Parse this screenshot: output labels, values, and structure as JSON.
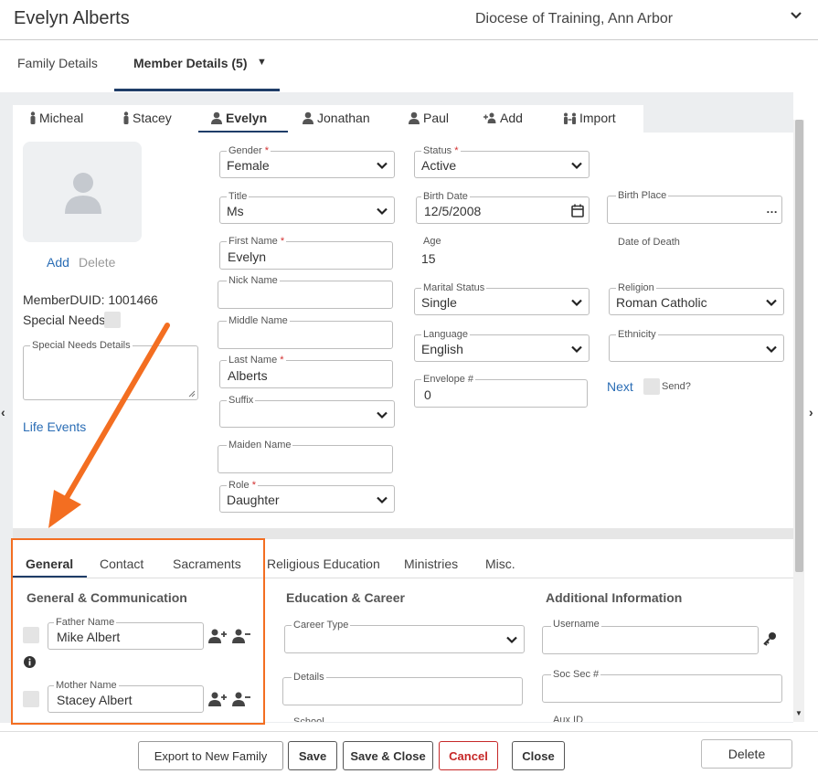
{
  "header": {
    "title": "Evelyn Alberts",
    "organization": "Diocese of Training, Ann Arbor"
  },
  "top_tabs": [
    {
      "label": "Family Details"
    },
    {
      "label": "Member Details (5)"
    }
  ],
  "member_tabs": [
    {
      "label": "Micheal"
    },
    {
      "label": "Stacey"
    },
    {
      "label": "Evelyn"
    },
    {
      "label": "Jonathan"
    },
    {
      "label": "Paul"
    },
    {
      "label": "Add"
    },
    {
      "label": "Import"
    }
  ],
  "photo": {
    "add": "Add",
    "delete": "Delete"
  },
  "member_duid": "MemberDUID: 1001466",
  "special_needs": "Special Needs",
  "special_needs_details": "Special Needs Details",
  "life_events": "Life Events",
  "fields": {
    "gender": {
      "label": "Gender",
      "value": "Female"
    },
    "title": {
      "label": "Title",
      "value": "Ms"
    },
    "first_name": {
      "label": "First Name",
      "value": "Evelyn"
    },
    "nick_name": {
      "label": "Nick Name",
      "value": ""
    },
    "middle_name": {
      "label": "Middle Name",
      "value": ""
    },
    "last_name": {
      "label": "Last Name",
      "value": "Alberts"
    },
    "suffix": {
      "label": "Suffix",
      "value": ""
    },
    "maiden_name": {
      "label": "Maiden Name",
      "value": ""
    },
    "role": {
      "label": "Role",
      "value": "Daughter"
    },
    "status": {
      "label": "Status",
      "value": "Active"
    },
    "birth_date": {
      "label": "Birth Date",
      "value": "12/5/2008"
    },
    "age": {
      "label": "Age",
      "value": "15"
    },
    "marital_status": {
      "label": "Marital Status",
      "value": "Single"
    },
    "language": {
      "label": "Language",
      "value": "English"
    },
    "envelope": {
      "label": "Envelope #",
      "value": "0"
    },
    "birth_place": {
      "label": "Birth Place",
      "value": ""
    },
    "date_of_death": {
      "label": "Date of Death",
      "value": ""
    },
    "religion": {
      "label": "Religion",
      "value": "Roman Catholic"
    },
    "ethnicity": {
      "label": "Ethnicity",
      "value": ""
    }
  },
  "required_mark": "*",
  "next_link": "Next",
  "send_label": "Send?",
  "bottom_tabs": [
    {
      "label": "General"
    },
    {
      "label": "Contact"
    },
    {
      "label": "Sacraments"
    },
    {
      "label": "Religious Education"
    },
    {
      "label": "Ministries"
    },
    {
      "label": "Misc."
    }
  ],
  "sections": {
    "general": "General & Communication",
    "education": "Education & Career",
    "additional": "Additional Information"
  },
  "general": {
    "father": {
      "label": "Father Name",
      "value": "Mike Albert"
    },
    "mother": {
      "label": "Mother Name",
      "value": "Stacey Albert"
    }
  },
  "education": {
    "career_type": "Career Type",
    "details": "Details",
    "school": "School"
  },
  "additional": {
    "username": "Username",
    "ssn": "Soc Sec #",
    "aux_id": "Aux ID"
  },
  "footer": {
    "export": "Export to New Family",
    "save": "Save",
    "save_close": "Save & Close",
    "cancel": "Cancel",
    "close": "Close",
    "delete": "Delete"
  },
  "colors": {
    "accent": "#1f3d68",
    "link": "#2a6db5",
    "annotation": "#f36e21",
    "cancel": "#c62828"
  }
}
